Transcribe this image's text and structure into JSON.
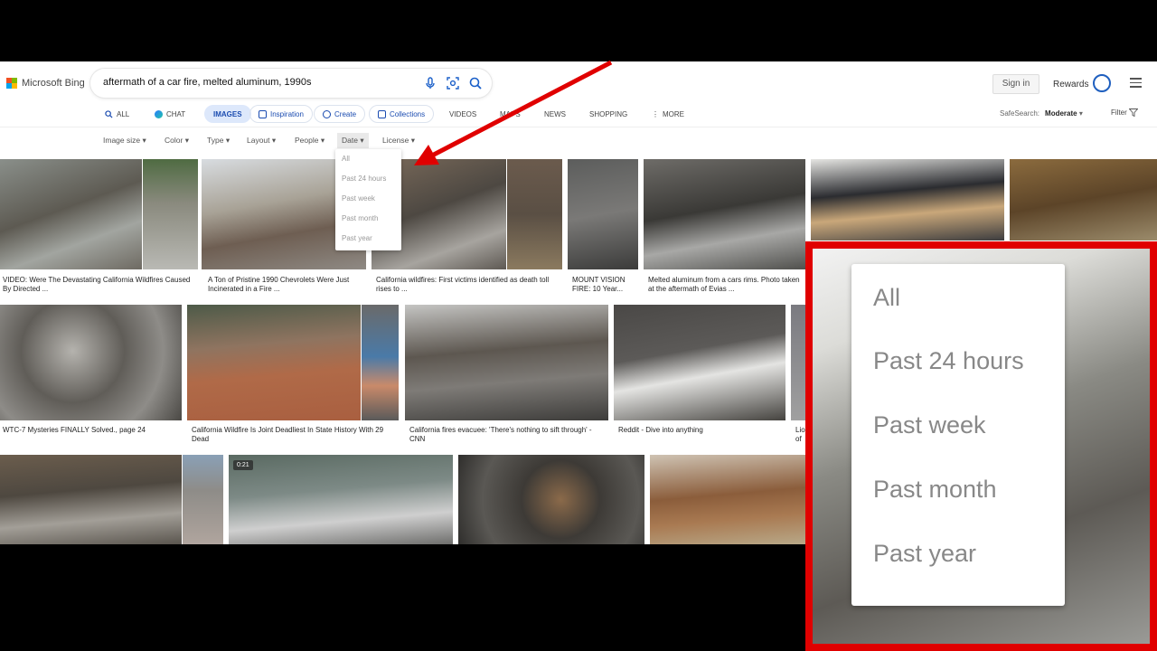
{
  "header": {
    "logo_text": "Microsoft Bing",
    "search_query": "aftermath of a car fire, melted aluminum, 1990s",
    "sign_in": "Sign in",
    "rewards": "Rewards"
  },
  "tabs": [
    {
      "label": "ALL"
    },
    {
      "label": "CHAT"
    },
    {
      "label": "IMAGES"
    },
    {
      "label": "Inspiration"
    },
    {
      "label": "Create"
    },
    {
      "label": "Collections"
    },
    {
      "label": "VIDEOS"
    },
    {
      "label": "MAPS"
    },
    {
      "label": "NEWS"
    },
    {
      "label": "SHOPPING"
    },
    {
      "label": "MORE"
    }
  ],
  "safesearch": {
    "label": "SafeSearch:",
    "value": "Moderate"
  },
  "filter_label": "Filter",
  "filters": [
    "Image size",
    "Color",
    "Type",
    "Layout",
    "People",
    "Date",
    "License"
  ],
  "date_dropdown": {
    "options": [
      "All",
      "Past 24 hours",
      "Past week",
      "Past month",
      "Past year"
    ]
  },
  "results": {
    "row1_captions": [
      "VIDEO: Were The Devastating California Wildfires Caused By Directed ...",
      "A Ton of Pristine 1990 Chevrolets Were Just Incinerated in a Fire ...",
      "California wildfires: First victims identified as death toll rises to ...",
      "MOUNT VISION FIRE: 10 Year...",
      "Melted aluminum from a cars rims. Photo taken at the aftermath of Evias ..."
    ],
    "row2_captions": [
      "WTC-7 Mysteries FINALLY Solved., page 24",
      "California Wildfire Is Joint Deadliest In State History With 29 Dead",
      "California fires evacuee: 'There's nothing to sift through' - CNN",
      "Reddit - Dive into anything",
      "Lio of"
    ],
    "video_badge": "0:21"
  },
  "colors": {
    "highlight_red": "#e00000",
    "accent_blue": "#1a4bb0"
  }
}
